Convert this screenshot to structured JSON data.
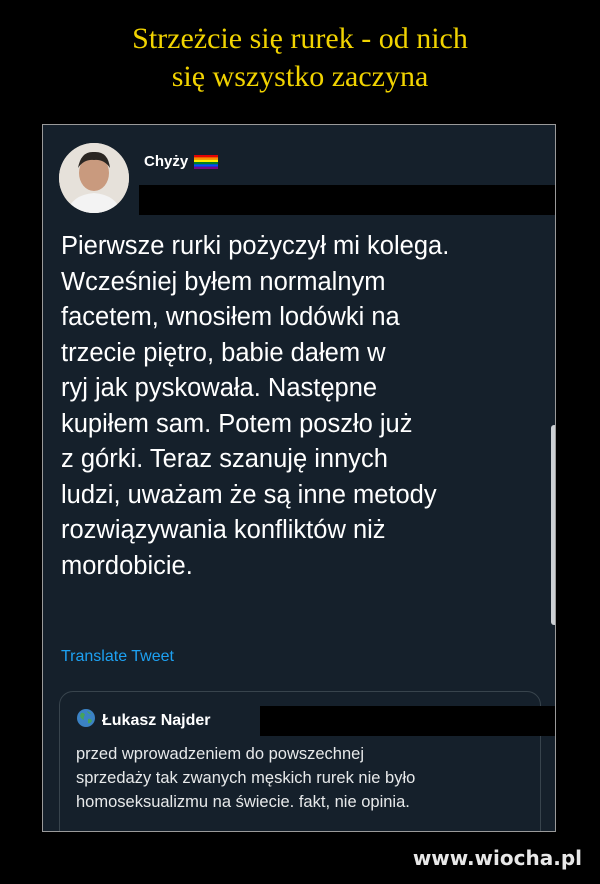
{
  "header": {
    "title_line1": "Strzeżcie się rurek - od nich",
    "title_line2": "się wszystko zaczyna"
  },
  "tweet": {
    "author": "Chyży",
    "text": "Pierwsze rurki pożyczył mi kolega.\nWcześniej byłem normalnym\nfacetem, wnosiłem lodówki na\ntrzecie piętro, babie dałem w\nryj jak pyskowała. Następne\nkupiłem sam. Potem poszło już\nz górki. Teraz szanuję innych\nludzi, uważam że są inne metody\nrozwiązywania konfliktów niż\nmordobicie.",
    "translate_label": "Translate Tweet"
  },
  "quoted": {
    "author": "Łukasz Najder",
    "text": "przed wprowadzeniem do powszechnej\nsprzedaży tak zwanych męskich rurek nie było\nhomoseksualizmu na świecie. fakt, nie opinia."
  },
  "watermark": "www.wiocha.pl",
  "colors": {
    "title": "#f1d300",
    "background": "#15202b",
    "link": "#1da1f2"
  },
  "icons": [
    "rainbow-flag-icon",
    "globe-icon"
  ]
}
